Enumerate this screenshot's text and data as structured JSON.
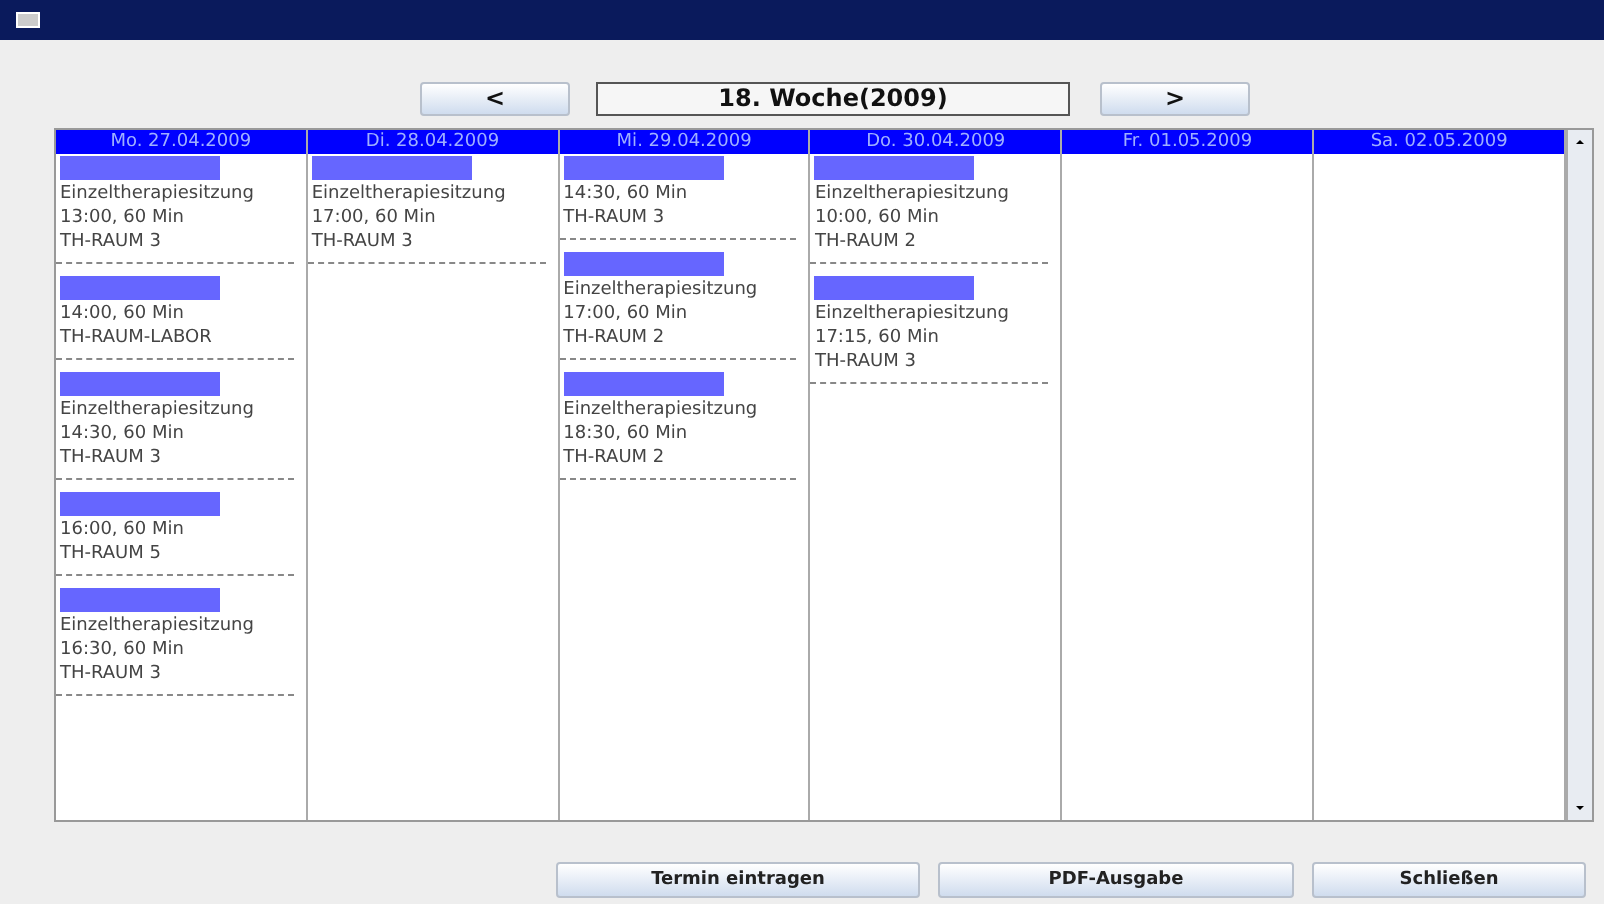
{
  "nav": {
    "prev": "<",
    "week": "18. Woche(2009)",
    "next": ">"
  },
  "days": [
    {
      "header": "Mo. 27.04.2009",
      "appointments": [
        {
          "lines": [
            "Einzeltherapiesitzung",
            "13:00, 60 Min",
            "TH-RAUM 3"
          ]
        },
        {
          "lines": [
            "14:00, 60 Min",
            "TH-RAUM-LABOR"
          ]
        },
        {
          "lines": [
            "Einzeltherapiesitzung",
            "14:30, 60 Min",
            "TH-RAUM 3"
          ]
        },
        {
          "lines": [
            "16:00, 60 Min",
            "TH-RAUM 5"
          ]
        },
        {
          "lines": [
            "Einzeltherapiesitzung",
            "16:30, 60 Min",
            "TH-RAUM 3"
          ]
        }
      ]
    },
    {
      "header": "Di. 28.04.2009",
      "appointments": [
        {
          "lines": [
            "Einzeltherapiesitzung",
            "17:00, 60 Min",
            "TH-RAUM 3"
          ]
        }
      ]
    },
    {
      "header": "Mi. 29.04.2009",
      "appointments": [
        {
          "lines": [
            "14:30, 60 Min",
            "TH-RAUM 3"
          ]
        },
        {
          "lines": [
            "Einzeltherapiesitzung",
            "17:00, 60 Min",
            "TH-RAUM 2"
          ]
        },
        {
          "lines": [
            "Einzeltherapiesitzung",
            "18:30, 60 Min",
            "TH-RAUM 2"
          ]
        }
      ]
    },
    {
      "header": "Do. 30.04.2009",
      "appointments": [
        {
          "lines": [
            "Einzeltherapiesitzung",
            "10:00, 60 Min",
            "TH-RAUM 2"
          ]
        },
        {
          "lines": [
            "Einzeltherapiesitzung",
            "17:15, 60 Min",
            "TH-RAUM 3"
          ]
        }
      ]
    },
    {
      "header": "Fr. 01.05.2009"
    },
    {
      "header": "Sa. 02.05.2009"
    }
  ],
  "buttons": [
    "Termin eintragen",
    "PDF-Ausgabe",
    "Schließen"
  ]
}
